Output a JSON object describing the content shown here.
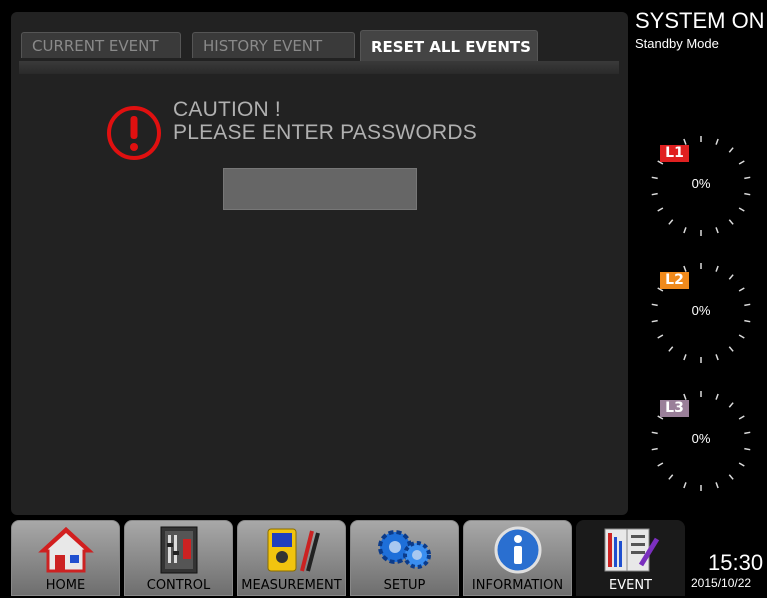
{
  "tabs": {
    "current_event": "CURRENT EVENT",
    "history_event": "HISTORY EVENT",
    "reset_all_events": "RESET ALL EVENTS"
  },
  "caution": {
    "line1": "CAUTION !",
    "line2": "PLEASE ENTER PASSWORDS"
  },
  "password": {
    "value": ""
  },
  "status": {
    "title": "SYSTEM ON",
    "mode": "Standby Mode"
  },
  "gauges": [
    {
      "phase": "L1",
      "percent": "0%",
      "color": "#e02020"
    },
    {
      "phase": "L2",
      "percent": "0%",
      "color": "#f08a1c"
    },
    {
      "phase": "L3",
      "percent": "0%",
      "color": "#9a7f99"
    }
  ],
  "clock": {
    "time": "15:30",
    "date": "2015/10/22"
  },
  "nav": {
    "home": "HOME",
    "control": "CONTROL",
    "measurement": "MEASUREMENT",
    "setup": "SETUP",
    "information": "INFORMATION",
    "event": "EVENT"
  },
  "colors": {
    "caution": "#e01010",
    "panel": "#222222"
  }
}
